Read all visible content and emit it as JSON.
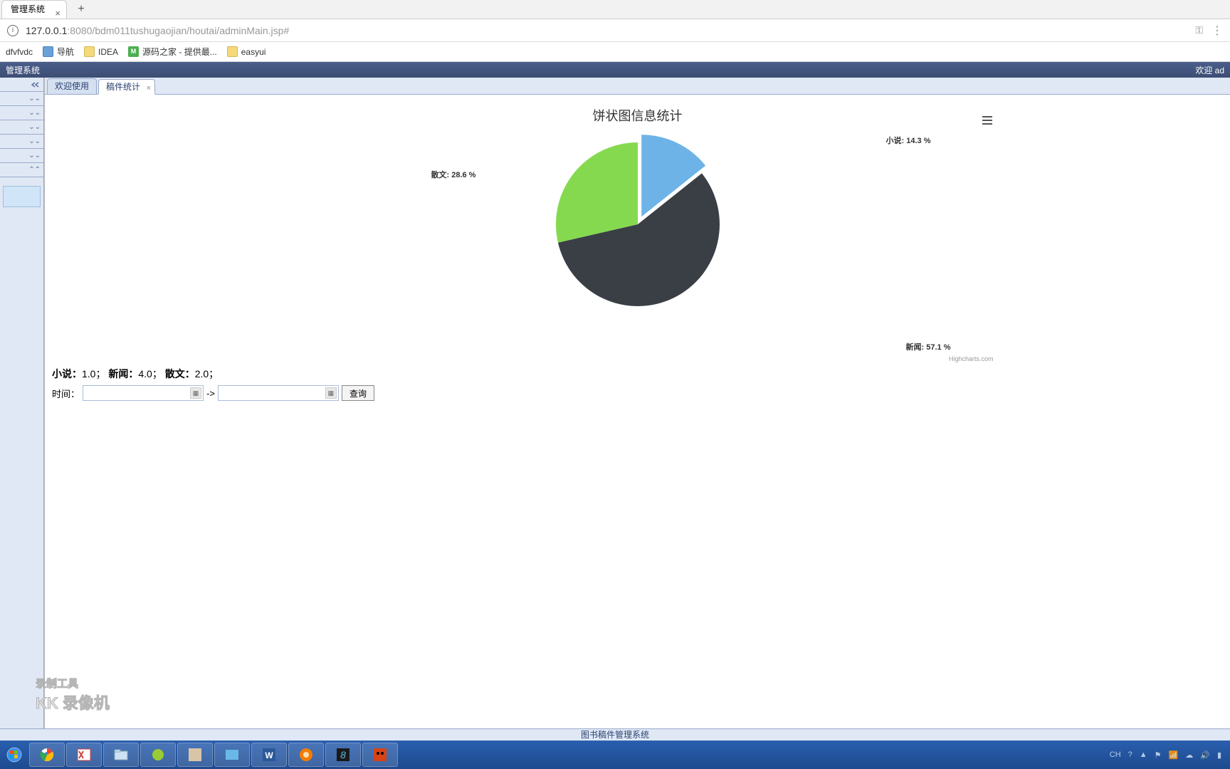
{
  "browser": {
    "tab_title": "管理系统",
    "url_prefix": "127.0.0.1",
    "url_rest": ":8080/bdm011tushugaojian/houtai/adminMain.jsp#",
    "bookmarks": [
      "dfvfvdc",
      "导航",
      "IDEA",
      "源码之家 - 提供最...",
      "easyui"
    ]
  },
  "app": {
    "header_left": "管理系统",
    "header_right": "欢迎 ad"
  },
  "tabs": {
    "tab0": "欢迎使用",
    "tab1": "稿件统计"
  },
  "chart_data": {
    "type": "pie",
    "title": "饼状图信息统计",
    "credits": "Highcharts.com",
    "series": [
      {
        "name": "小说",
        "pct": 14.3,
        "color": "#6db3e8"
      },
      {
        "name": "新闻",
        "pct": 57.1,
        "color": "#3a3f45"
      },
      {
        "name": "散文",
        "pct": 28.6,
        "color": "#85d94f"
      }
    ],
    "labels": {
      "l0": "小说: 14.3 %",
      "l1": "新闻: 57.1 %",
      "l2": "散文: 28.6 %"
    }
  },
  "summary": {
    "novel_label": "小说：",
    "novel_val": "1.0；",
    "news_label": "新闻：",
    "news_val": "4.0；",
    "prose_label": "散文：",
    "prose_val": "2.0；"
  },
  "form": {
    "time_label": "时间：",
    "arrow": " -> ",
    "query": "查询"
  },
  "watermark": {
    "top": "录制工具",
    "bottom": "KK 录像机"
  },
  "footer": "图书稿件管理系统",
  "tray": {
    "lang": "CH"
  }
}
